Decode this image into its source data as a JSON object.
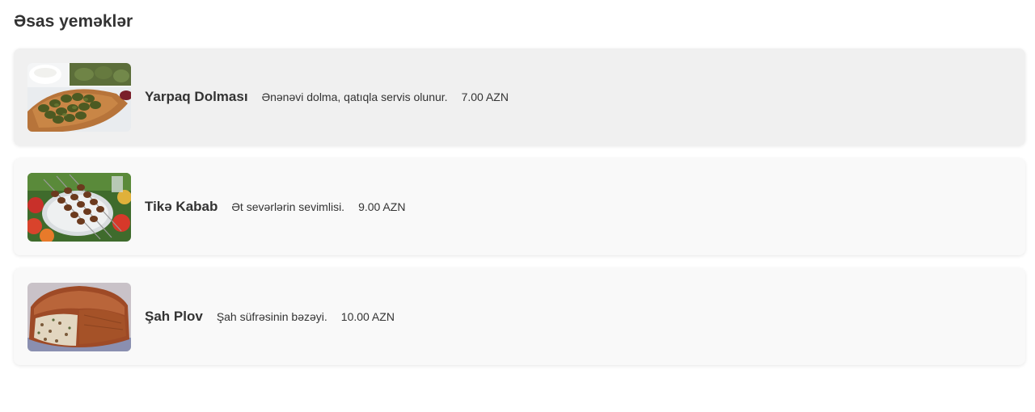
{
  "section": {
    "title": "Əsas yeməklər"
  },
  "items": [
    {
      "name": "Yarpaq Dolması",
      "description": "Ənənəvi dolma, qatıqla servis olunur.",
      "price": "7.00 AZN",
      "image": "dolma-photo"
    },
    {
      "name": "Tikə Kabab",
      "description": "Ət sevərlərin sevimlisi.",
      "price": "9.00 AZN",
      "image": "kebab-photo"
    },
    {
      "name": "Şah Plov",
      "description": "Şah süfrəsinin bəzəyi.",
      "price": "10.00 AZN",
      "image": "plov-photo"
    }
  ],
  "colors": {
    "card_background": "#f9f9f9",
    "card_hover_background": "#f0f0f0",
    "text": "#333333"
  }
}
